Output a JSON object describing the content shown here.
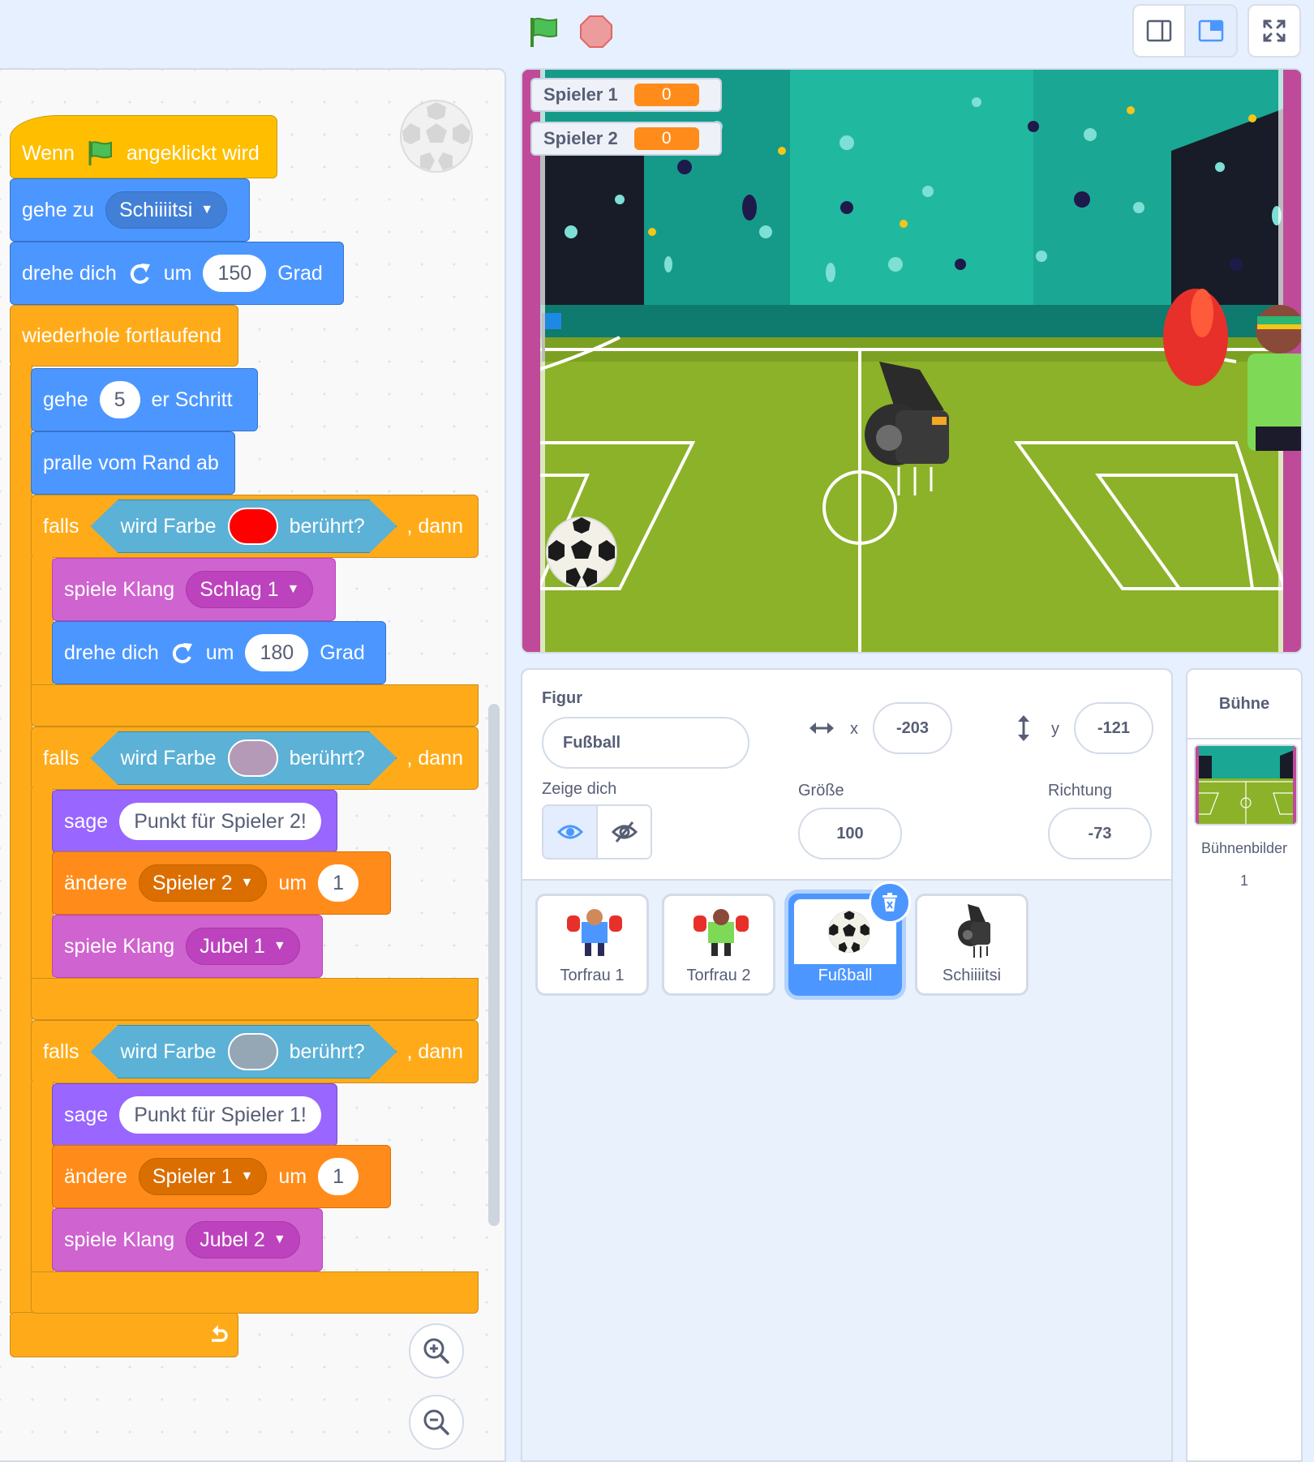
{
  "controls": {
    "green_flag": "green-flag",
    "stop": "stop-sign"
  },
  "script": {
    "hat": {
      "prefix": "Wenn",
      "suffix": "angeklickt wird"
    },
    "goto": {
      "label": "gehe zu",
      "target": "Schiiiitsi"
    },
    "turn1": {
      "label": "drehe dich",
      "um": "um",
      "value": "150",
      "unit": "Grad"
    },
    "forever": {
      "label": "wiederhole fortlaufend"
    },
    "move": {
      "label": "gehe",
      "value": "5",
      "suffix": "er Schritt"
    },
    "bounce": {
      "label": "pralle vom Rand ab"
    },
    "if1": {
      "falls": "falls",
      "cond": "wird Farbe",
      "cond2": "berührt?",
      "dann": ", dann",
      "color": "#ff0000"
    },
    "play1": {
      "label": "spiele Klang",
      "sound": "Schlag 1"
    },
    "turn2": {
      "label": "drehe dich",
      "um": "um",
      "value": "180",
      "unit": "Grad"
    },
    "if2": {
      "falls": "falls",
      "cond": "wird Farbe",
      "cond2": "berührt?",
      "dann": ", dann",
      "color": "#b59ab7"
    },
    "say2": {
      "label": "sage",
      "text": "Punkt für Spieler 2!"
    },
    "change2": {
      "label": "ändere",
      "var": "Spieler 2",
      "um": "um",
      "value": "1"
    },
    "play2": {
      "label": "spiele Klang",
      "sound": "Jubel 1"
    },
    "if3": {
      "falls": "falls",
      "cond": "wird Farbe",
      "cond2": "berührt?",
      "dann": ", dann",
      "color": "#95a6b5"
    },
    "say1": {
      "label": "sage",
      "text": "Punkt für Spieler 1!"
    },
    "change1": {
      "label": "ändere",
      "var": "Spieler 1",
      "um": "um",
      "value": "1"
    },
    "play3": {
      "label": "spiele Klang",
      "sound": "Jubel 2"
    }
  },
  "stage": {
    "monitors": [
      {
        "name": "Spieler 1",
        "value": "0"
      },
      {
        "name": "Spieler 2",
        "value": "0"
      }
    ]
  },
  "sprite_info": {
    "figur_label": "Figur",
    "name": "Fußball",
    "x_label": "x",
    "x": "-203",
    "y_label": "y",
    "y": "-121",
    "show_label": "Zeige dich",
    "size_label": "Größe",
    "size": "100",
    "direction_label": "Richtung",
    "direction": "-73"
  },
  "sprites": [
    {
      "name": "Torfrau 1"
    },
    {
      "name": "Torfrau 2"
    },
    {
      "name": "Fußball"
    },
    {
      "name": "Schiiiitsi"
    }
  ],
  "buehne": {
    "title": "Bühne",
    "backdrops_label": "Bühnenbilder",
    "backdrops_count": "1"
  }
}
